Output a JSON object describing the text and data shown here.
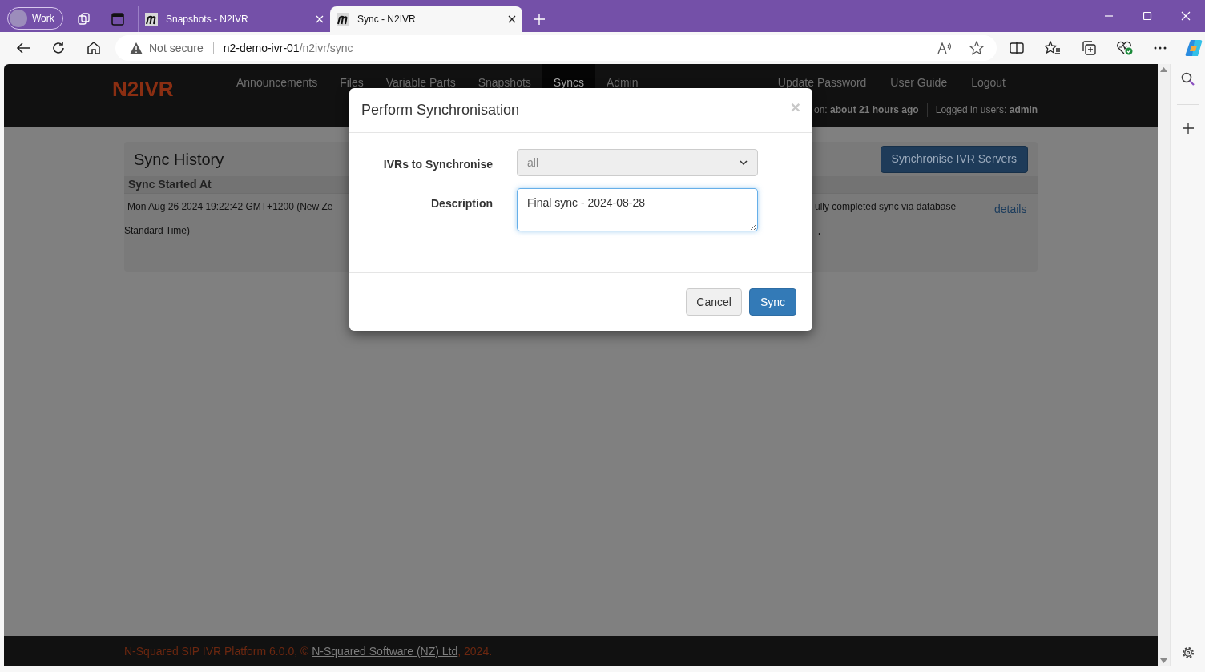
{
  "browser": {
    "profile": "Work",
    "tabs": [
      {
        "title": "Snapshots - N2IVR",
        "selected": false
      },
      {
        "title": "Sync - N2IVR",
        "selected": true
      }
    ],
    "address": {
      "security": "Not secure",
      "host": "n2-demo-ivr-01",
      "path": "/n2ivr/sync"
    }
  },
  "app": {
    "brand": "N2IVR",
    "nav": [
      {
        "label": "Announcements",
        "selected": false
      },
      {
        "label": "Files",
        "selected": false
      },
      {
        "label": "Variable Parts",
        "selected": false
      },
      {
        "label": "Snapshots",
        "selected": false
      },
      {
        "label": "Syncs",
        "selected": true
      },
      {
        "label": "Admin",
        "selected": false
      }
    ],
    "user_links": [
      "Update Password",
      "User Guide",
      "Logout"
    ],
    "status": [
      "on: **about 21 hours ago**",
      "Logged in users: **admin**"
    ],
    "panel": {
      "title": "Sync History",
      "button": "Synchronise IVR Servers",
      "columns": [
        "Sync Started At"
      ],
      "rows": [
        {
          "column_1": [
            "Mon Aug 26 2024 19:22:42 GMT+1200 (New Ze",
            "Standard Time)"
          ],
          "column_2": [
            "ully completed sync via database",
            "."
          ],
          "link": "details"
        }
      ]
    },
    "footer": {
      "before": "N-Squared SIP IVR Platform 6.0.0, © ",
      "link": "N-Squared Software (NZ) Ltd",
      "after": ", 2024."
    }
  },
  "modal": {
    "title": "Perform Synchronisation",
    "close": "×",
    "fields": [
      {
        "kind": "select",
        "label": "IVRs to Synchronise",
        "value": "all",
        "disabled": true
      },
      {
        "kind": "textarea",
        "label": "Description",
        "value": "Final sync - 2024-08-28",
        "focused": true
      }
    ],
    "buttons": [
      {
        "label": "Cancel",
        "primary": false
      },
      {
        "label": "Sync",
        "primary": true
      }
    ]
  }
}
